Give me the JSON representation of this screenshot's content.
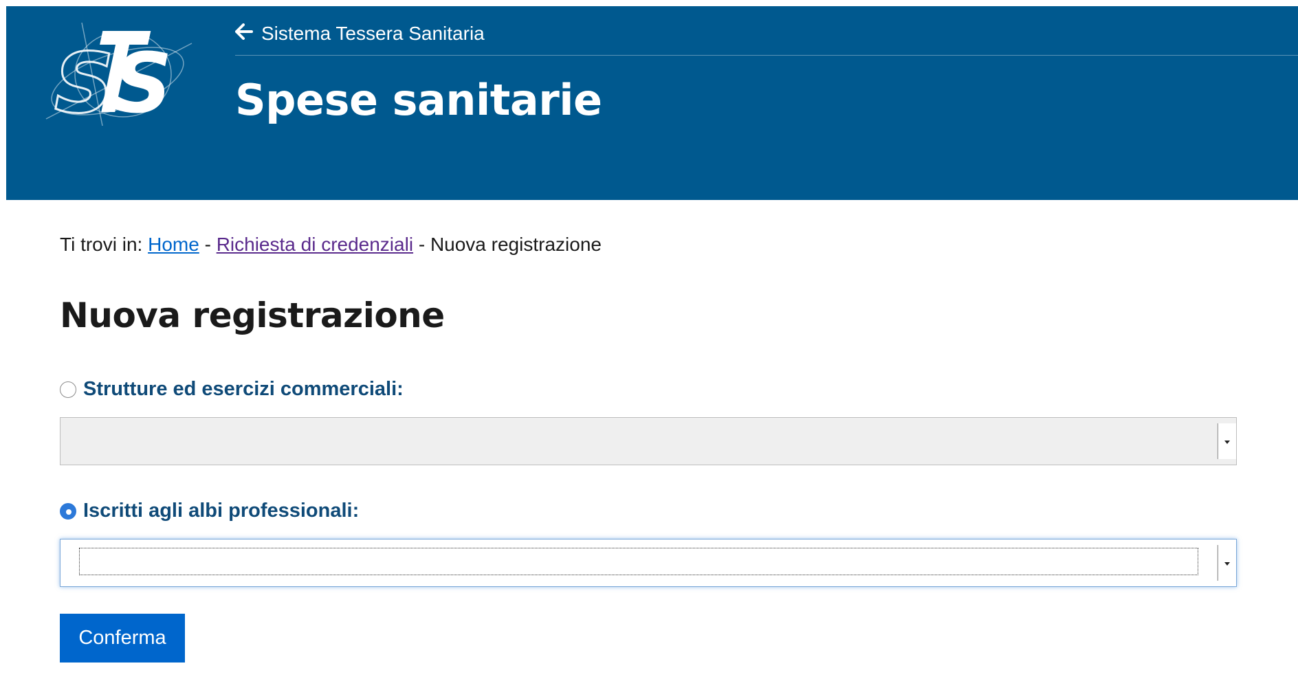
{
  "header": {
    "back_link": "Sistema Tessera Sanitaria",
    "app_title": "Spese sanitarie",
    "logo_alt": "STS",
    "background_color": "#00598f"
  },
  "breadcrumb": {
    "prefix": "Ti trovi in:",
    "items": [
      "Home",
      "Richiesta di credenziali",
      "Nuova registrazione"
    ],
    "separator": "-"
  },
  "main": {
    "title": "Nuova registrazione",
    "options": [
      {
        "label": "Strutture ed esercizi commerciali:",
        "checked": false,
        "select_value": "",
        "select_disabled": true
      },
      {
        "label": "Iscritti agli albi professionali:",
        "checked": true,
        "select_value": "",
        "select_disabled": false
      }
    ],
    "confirm_label": "Conferma"
  },
  "colors": {
    "accent": "#0066cc",
    "label": "#0f4a78",
    "visited_link": "#5a2a8c"
  }
}
